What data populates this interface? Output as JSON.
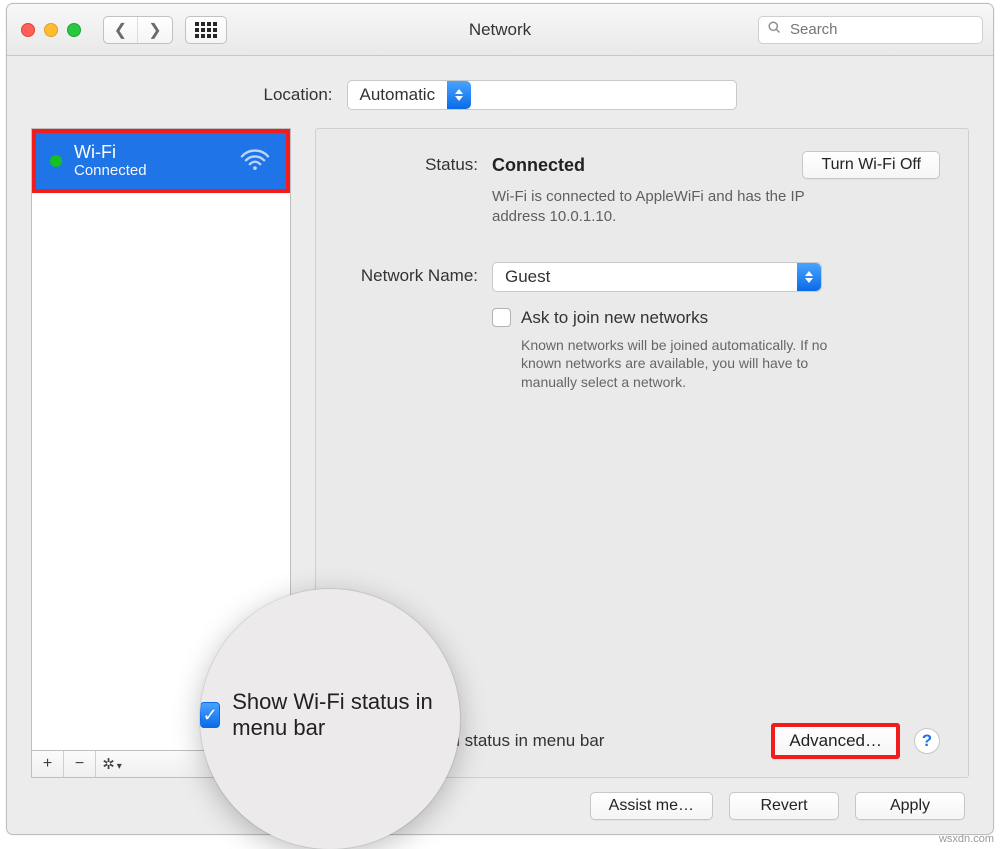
{
  "window": {
    "title": "Network"
  },
  "search": {
    "placeholder": "Search"
  },
  "location": {
    "label": "Location:",
    "value": "Automatic"
  },
  "sidebar": {
    "items": [
      {
        "name": "Wi-Fi",
        "status": "Connected"
      }
    ],
    "buttons": {
      "add": "+",
      "remove": "−",
      "gear": "✻"
    }
  },
  "detail": {
    "status_label": "Status:",
    "status_value": "Connected",
    "turn_off": "Turn Wi-Fi Off",
    "status_desc": "Wi-Fi is connected to AppleWiFi and has the IP address 10.0.1.10.",
    "network_label": "Network Name:",
    "network_value": "Guest",
    "ask_join": "Ask to join new networks",
    "ask_help": "Known networks will be joined automatically. If no known networks are available, you will have to manually select a network.",
    "show_status": "Show Wi-Fi status in menu bar",
    "advanced": "Advanced…",
    "help": "?"
  },
  "footer": {
    "assist": "Assist me…",
    "revert": "Revert",
    "apply": "Apply"
  },
  "magnifier": {
    "label_a": "Show Wi-Fi",
    "label_b": " status in menu bar"
  },
  "watermark": "wsxdn.com"
}
